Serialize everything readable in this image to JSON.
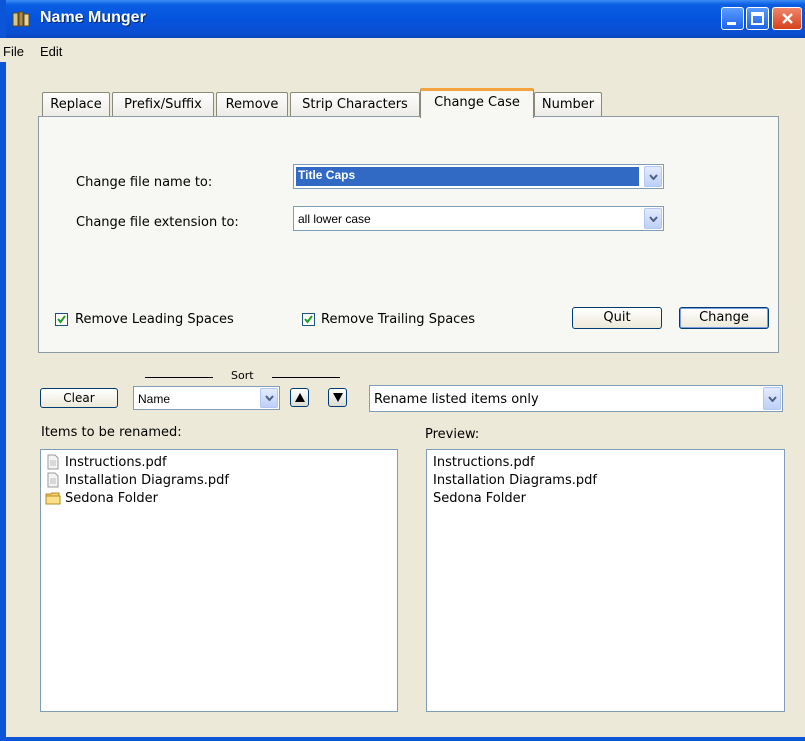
{
  "window": {
    "title": "Name Munger"
  },
  "menu": {
    "file": "File",
    "edit": "Edit"
  },
  "tabs": [
    "Replace",
    "Prefix/Suffix",
    "Remove",
    "Strip Characters",
    "Change Case",
    "Number"
  ],
  "active_tab": "Change Case",
  "change_case": {
    "name_label": "Change file name to:",
    "name_value": "Title Caps",
    "ext_label": "Change file extension to:",
    "ext_value": "all lower case",
    "leading_label": "Remove Leading Spaces",
    "trailing_label": "Remove Trailing Spaces",
    "leading_checked": true,
    "trailing_checked": true,
    "quit_label": "Quit",
    "change_label": "Change"
  },
  "controls": {
    "clear_label": "Clear",
    "sort_label": "Sort",
    "sort_value": "Name",
    "scope_value": "Rename listed items only"
  },
  "items_panel": {
    "label": "Items to be renamed:",
    "items": [
      {
        "name": "Instructions.pdf",
        "icon": "document-icon"
      },
      {
        "name": "Installation Diagrams.pdf",
        "icon": "document-icon"
      },
      {
        "name": "Sedona Folder",
        "icon": "folder-icon"
      }
    ]
  },
  "preview_panel": {
    "label": "Preview:",
    "items": [
      "Instructions.pdf",
      "Installation Diagrams.pdf",
      "Sedona Folder"
    ]
  },
  "colors": {
    "titlebar": "#0553dd",
    "selection": "#316ac5",
    "active_tab_accent": "#f3a43c",
    "window_bg": "#ece9d8"
  }
}
